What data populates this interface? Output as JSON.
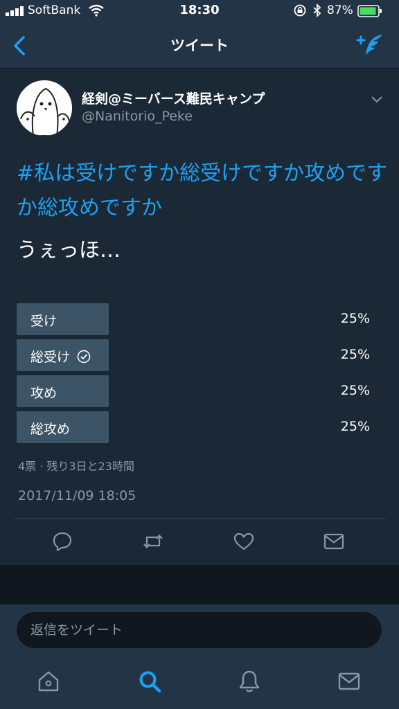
{
  "status_bar": {
    "carrier": "SoftBank",
    "time": "18:30",
    "battery_pct": "87%"
  },
  "nav": {
    "title": "ツイート",
    "back_icon": "chevron-left-icon",
    "compose_icon": "compose-tweet-icon"
  },
  "tweet": {
    "display_name": "経剣@ミーバース難民キャンプ",
    "handle": "@Nanitorio_Peke",
    "hashtag_text": "#私は受けですか総受けですか攻めですか総攻めですか",
    "body": "うぇっほ…",
    "poll": {
      "options": [
        {
          "label": "受け",
          "percent": "25%",
          "fill": 0.25,
          "selected": false
        },
        {
          "label": "総受け",
          "percent": "25%",
          "fill": 0.25,
          "selected": true
        },
        {
          "label": "攻め",
          "percent": "25%",
          "fill": 0.25,
          "selected": false
        },
        {
          "label": "総攻め",
          "percent": "25%",
          "fill": 0.25,
          "selected": false
        }
      ],
      "meta": "4票 · 残り3日と23時間"
    },
    "timestamp": "2017/11/09 18:05",
    "actions": [
      "reply-icon",
      "retweet-icon",
      "like-icon",
      "message-icon"
    ]
  },
  "reply": {
    "placeholder": "返信をツイート"
  },
  "tabs": [
    "home-icon",
    "search-icon",
    "notifications-icon",
    "messages-icon"
  ],
  "colors": {
    "accent": "#1da1f2",
    "background": "#1b2836",
    "bar": "#243447",
    "poll_fill": "#3d5466",
    "muted": "#8899a6"
  }
}
